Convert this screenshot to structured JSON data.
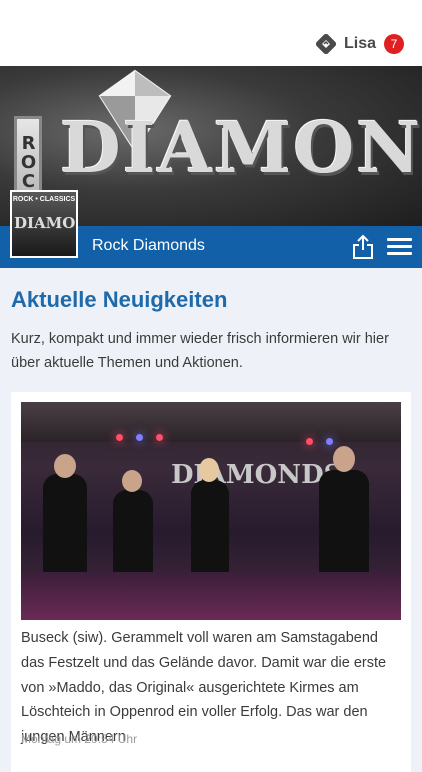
{
  "header": {
    "user_name": "Lisa",
    "notification_count": "7"
  },
  "hero": {
    "brand_word": "DIAMONDS",
    "rock_label": "ROCK"
  },
  "titlebar": {
    "title": "Rock Diamonds",
    "avatar_caption": "ROCK • CLASSICS",
    "avatar_logo": "DIAMONDS",
    "share_icon": "share-icon",
    "menu_icon": "hamburger-menu-icon"
  },
  "main": {
    "heading": "Aktuelle Neuigkeiten",
    "intro": "Kurz, kompakt und immer wieder frisch informieren wir hier über aktuelle Themen und Aktionen."
  },
  "news": [
    {
      "photo_sign": "DIAMONDS",
      "text": "Buseck (siw). Gerammelt voll waren am Samstagabend das Festzelt und das Gelände davor. Damit war die erste von »Maddo, das Original« ausgerichtete Kirmes am Löschteich in Oppenrod ein voller Erfolg. Das war den jungen Männern",
      "timestamp": "Montag um 20:54 Uhr"
    }
  ],
  "colors": {
    "accent_blue": "#1160a8",
    "heading_blue": "#1f6aab",
    "badge_red": "#e02020",
    "background": "#eef2f8"
  }
}
